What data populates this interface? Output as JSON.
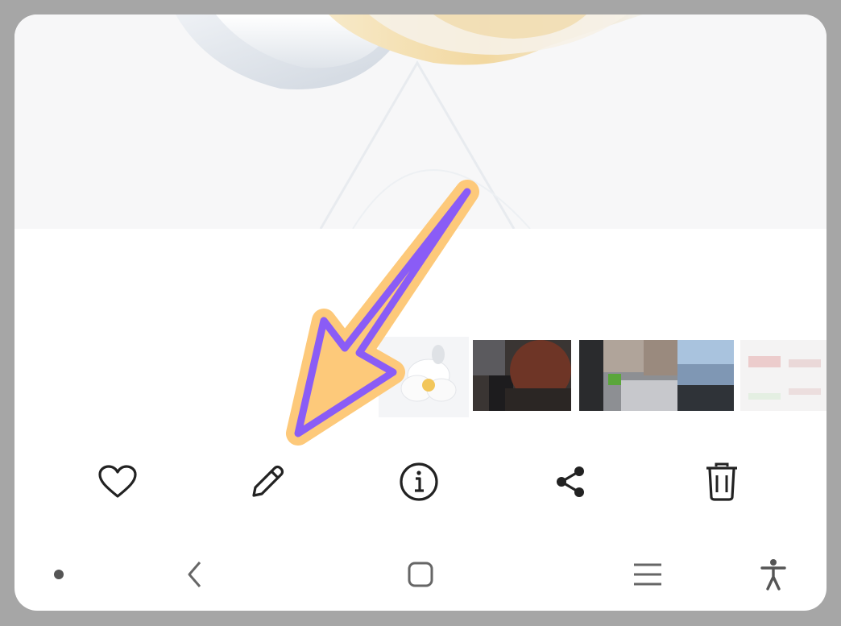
{
  "viewer": {
    "photo_icon": "white-flower-wallpaper"
  },
  "thumbnails": [
    {
      "icon": "flower-thumbnail",
      "current": true
    },
    {
      "icon": "blurred-thumbnail"
    },
    {
      "icon": "blurred-thumbnail"
    },
    {
      "icon": "blurred-thumbnail"
    },
    {
      "icon": "blurred-thumbnail"
    }
  ],
  "actions": [
    {
      "icon": "heart-icon",
      "name": "favorite"
    },
    {
      "icon": "pencil-icon",
      "name": "edit"
    },
    {
      "icon": "info-icon",
      "name": "details"
    },
    {
      "icon": "share-icon",
      "name": "share"
    },
    {
      "icon": "trash-icon",
      "name": "delete"
    }
  ],
  "navigation": [
    {
      "icon": "dot-icon"
    },
    {
      "icon": "back-icon"
    },
    {
      "icon": "home-icon"
    },
    {
      "icon": "recents-icon"
    },
    {
      "icon": "accessibility-icon"
    }
  ],
  "annotation": {
    "type": "arrow",
    "points_to": "edit",
    "fill_color": "#fdc97a",
    "outline_color": "#8a5cf6"
  }
}
